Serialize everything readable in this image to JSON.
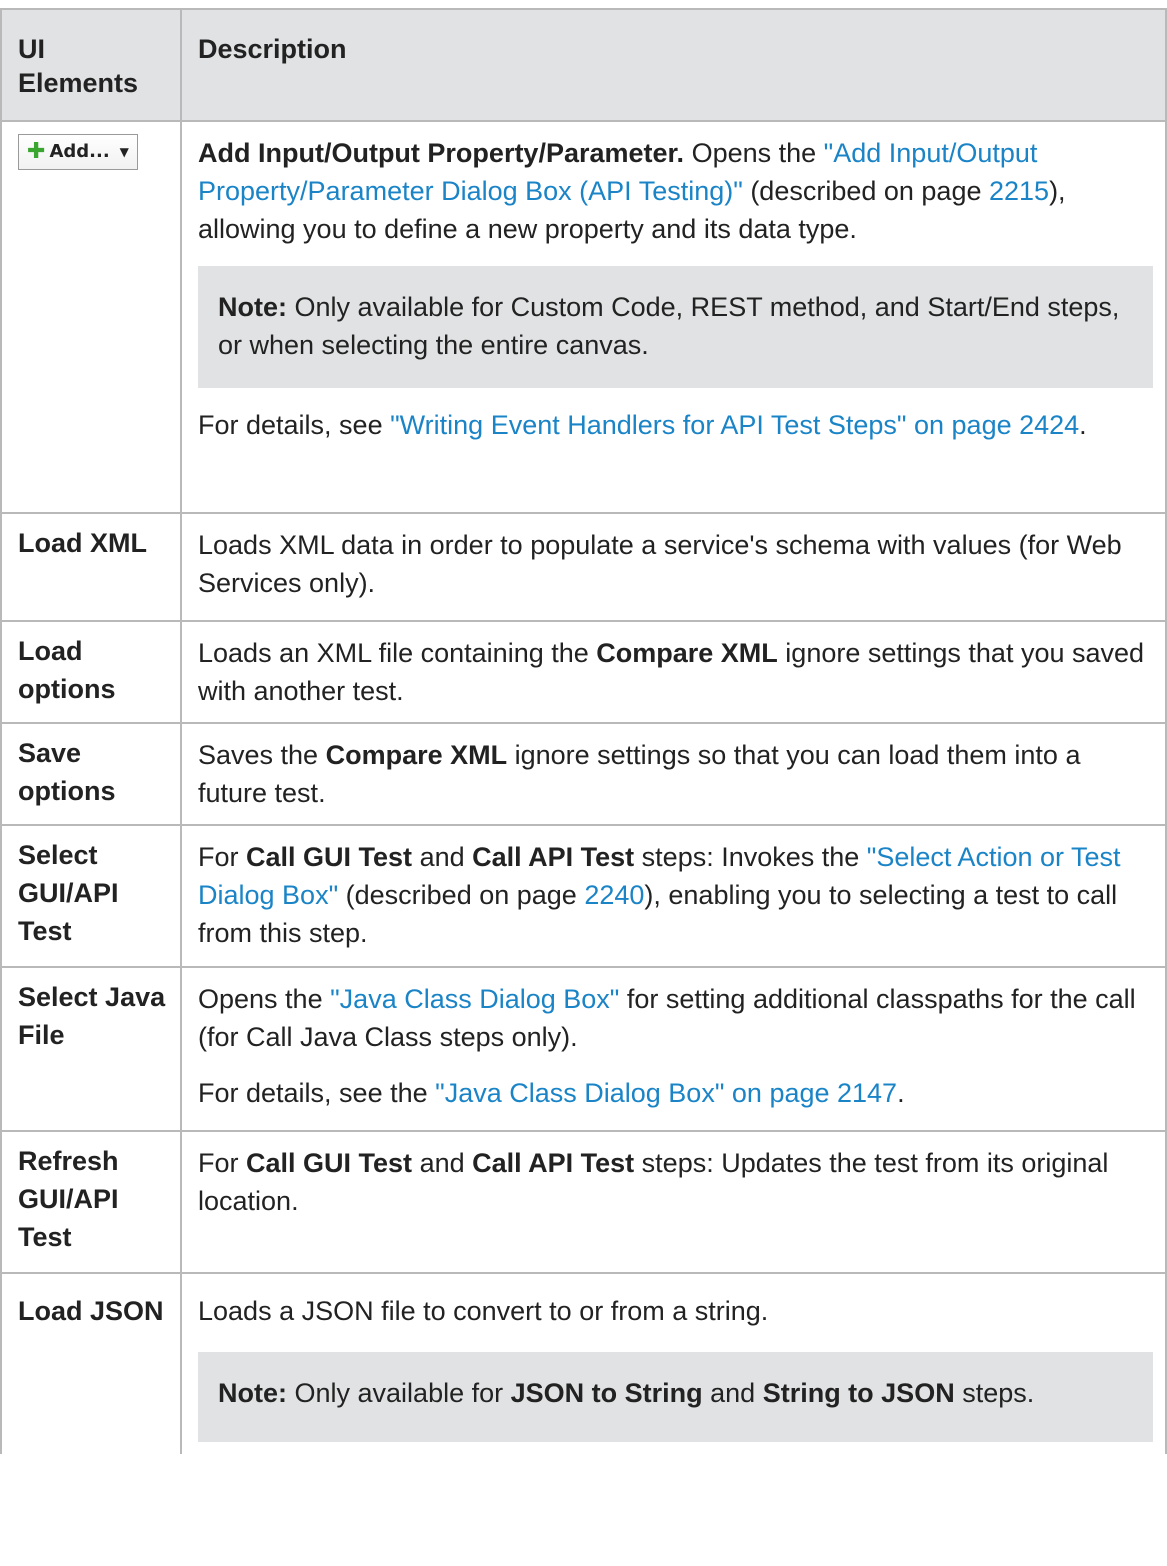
{
  "header": {
    "col1": "UI Elements",
    "col2": "Description"
  },
  "rows": [
    {
      "button": {
        "label": "Add...",
        "icon": "plus-icon"
      },
      "desc": {
        "title": "Add Input/Output Property/Parameter.",
        "t1": " Opens the ",
        "link1": "\"Add Input/Output Property/Parameter Dialog Box (API Testing)\"",
        "t2": " (described on page ",
        "page1": "2215",
        "t3": "), allowing you to define a new property and its data type.",
        "note_label": "Note:",
        "note_text": " Only available for Custom Code, REST method, and Start/End steps, or when selecting the entire canvas.",
        "details_pre": "For details, see ",
        "details_link": "\"Writing Event Handlers for API Test Steps\" on page 2424",
        "details_post": "."
      }
    },
    {
      "name": "Load XML",
      "desc": {
        "text": "Loads XML data in order to populate a service's schema with values (for Web Services only)."
      }
    },
    {
      "name": "Load options",
      "desc": {
        "t1": "Loads an XML file containing the ",
        "b1": "Compare XML",
        "t2": " ignore settings that you saved with another test."
      }
    },
    {
      "name": "Save options",
      "desc": {
        "t1": "Saves the ",
        "b1": "Compare XML",
        "t2": " ignore settings so that you can load them into a future test."
      }
    },
    {
      "name": "Select GUI/API Test",
      "desc": {
        "t1": "For ",
        "b1": "Call GUI Test",
        "t2": " and ",
        "b2": "Call API Test",
        "t3": " steps: Invokes the ",
        "link1": "\"Select Action or Test Dialog Box\"",
        "t4": " (described on page ",
        "page1": "2240",
        "t5": "), enabling you to selecting a test to call from this step."
      }
    },
    {
      "name": "Select Java File",
      "desc": {
        "t1": "Opens the ",
        "link1": "\"Java Class Dialog Box\"",
        "t2": " for setting additional classpaths for the call (for Call Java Class steps only).",
        "details_pre": "For details, see the ",
        "details_link": "\"Java Class Dialog Box\" on page 2147",
        "details_post": "."
      }
    },
    {
      "name": "Refresh GUI/API Test",
      "desc": {
        "t1": "For ",
        "b1": "Call GUI Test",
        "t2": " and ",
        "b2": "Call API Test",
        "t3": " steps: Updates the test from its original location."
      }
    },
    {
      "name": "Load JSON",
      "desc": {
        "text": "Loads a JSON file to convert to or from a string.",
        "note_label": "Note:",
        "n1": " Only available for ",
        "nb1": "JSON to String",
        "n2": " and ",
        "nb2": "String to JSON",
        "n3": " steps."
      }
    }
  ]
}
